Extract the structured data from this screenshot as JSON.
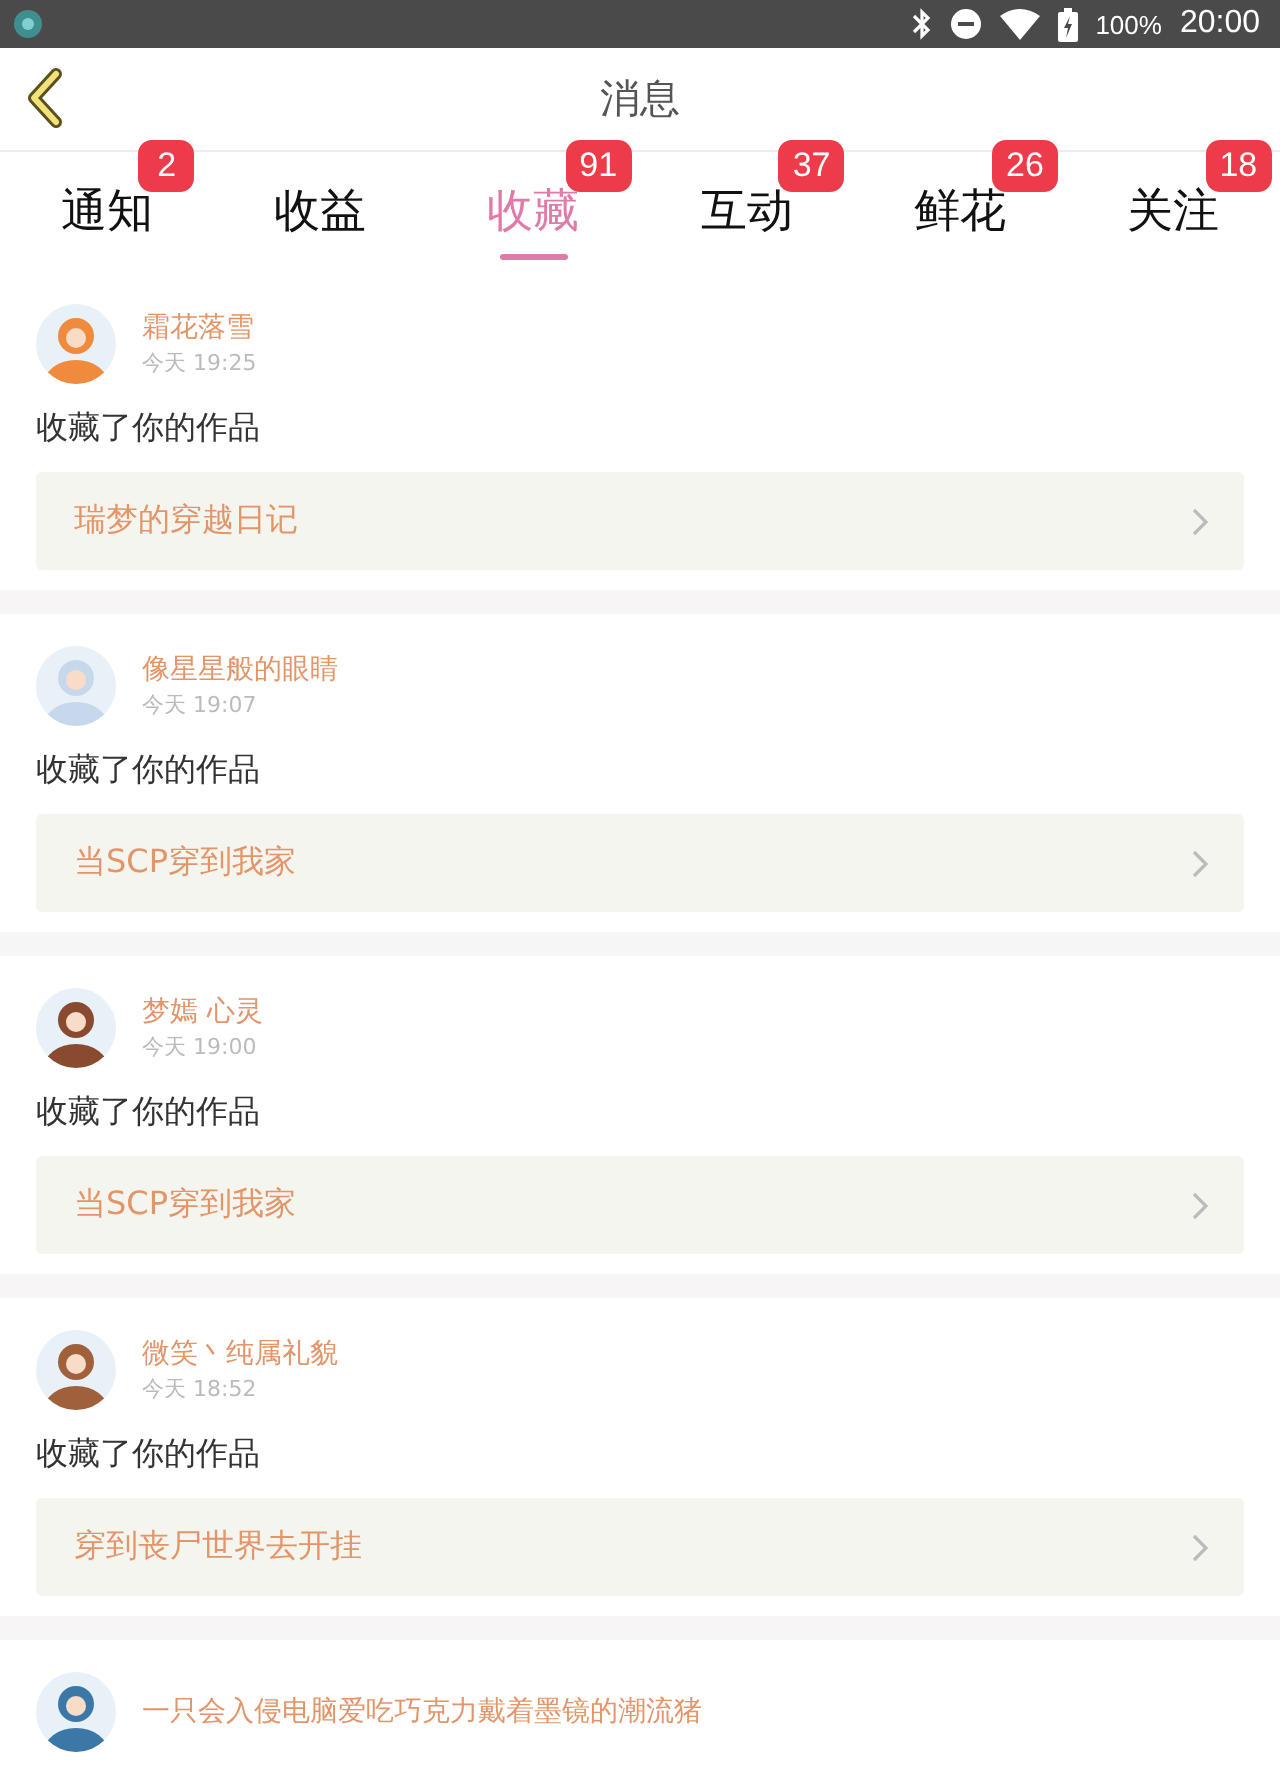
{
  "status_bar": {
    "battery": "100%",
    "time": "20:00"
  },
  "header": {
    "title": "消息"
  },
  "tabs": [
    {
      "label": "通知",
      "badge": "2",
      "selected": false
    },
    {
      "label": "收益",
      "selected": false
    },
    {
      "label": "收藏",
      "badge": "91",
      "selected": true
    },
    {
      "label": "互动",
      "badge": "37",
      "selected": false
    },
    {
      "label": "鲜花",
      "badge": "26",
      "selected": false
    },
    {
      "label": "关注",
      "badge": "18",
      "selected": false
    }
  ],
  "messages": [
    {
      "name": "霜花落雪",
      "time": "今天 19:25",
      "text": "收藏了你的作品",
      "work": "瑞梦的穿越日记"
    },
    {
      "name": "像星星般的眼睛",
      "time": "今天 19:07",
      "text": "收藏了你的作品",
      "work": "当SCP穿到我家"
    },
    {
      "name": "梦嫣 心灵",
      "time": "今天 19:00",
      "text": "收藏了你的作品",
      "work": "当SCP穿到我家"
    },
    {
      "name": "微笑丶纯属礼貌",
      "time": "今天 18:52",
      "text": "收藏了你的作品",
      "work": "穿到丧尸世界去开挂"
    },
    {
      "name": "一只会入侵电脑爱吃巧克力戴着墨镜的潮流猪"
    }
  ]
}
